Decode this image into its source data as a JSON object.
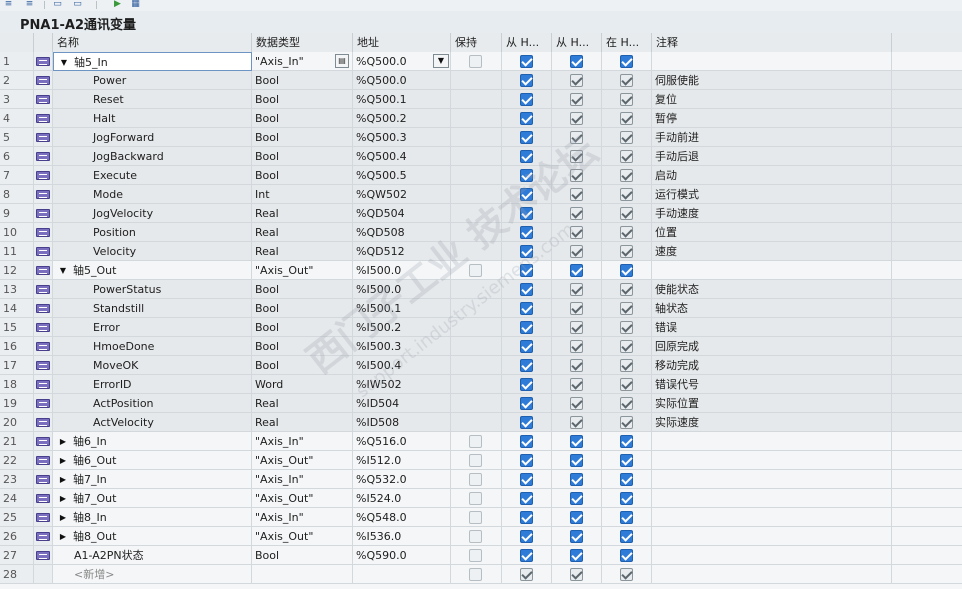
{
  "window": {
    "title": "PNA1-A2通讯变量"
  },
  "toolbar": {
    "icons": [
      "insert-row-icon",
      "add-row-icon",
      "expand-icon",
      "collapse-icon",
      "monitor-icon",
      "watch-icon"
    ]
  },
  "columns": {
    "name": "名称",
    "datatype": "数据类型",
    "address": "地址",
    "retain": "保持",
    "from_hmi1": "从 H...",
    "from_hmi2": "从 H...",
    "in_hmi": "在 H...",
    "comment": "注释"
  },
  "rows": [
    {
      "num": "1",
      "name": "轴5_In",
      "type": "\"Axis_In\"",
      "addr": "%Q500.0",
      "comment": "",
      "kind": "top",
      "expand": "open",
      "selected": true,
      "retain": "off",
      "f1": "on",
      "f2": "on",
      "ih": "on"
    },
    {
      "num": "2",
      "name": "Power",
      "type": "Bool",
      "addr": "%Q500.0",
      "comment": "伺服使能",
      "kind": "child",
      "retain": "none",
      "f1": "on",
      "f2": "gray",
      "ih": "gray"
    },
    {
      "num": "3",
      "name": "Reset",
      "type": "Bool",
      "addr": "%Q500.1",
      "comment": "复位",
      "kind": "child",
      "retain": "none",
      "f1": "on",
      "f2": "gray",
      "ih": "gray"
    },
    {
      "num": "4",
      "name": "Halt",
      "type": "Bool",
      "addr": "%Q500.2",
      "comment": "暂停",
      "kind": "child",
      "retain": "none",
      "f1": "on",
      "f2": "gray",
      "ih": "gray"
    },
    {
      "num": "5",
      "name": "JogForward",
      "type": "Bool",
      "addr": "%Q500.3",
      "comment": "手动前进",
      "kind": "child",
      "retain": "none",
      "f1": "on",
      "f2": "gray",
      "ih": "gray"
    },
    {
      "num": "6",
      "name": "JogBackward",
      "type": "Bool",
      "addr": "%Q500.4",
      "comment": "手动后退",
      "kind": "child",
      "retain": "none",
      "f1": "on",
      "f2": "gray",
      "ih": "gray"
    },
    {
      "num": "7",
      "name": "Execute",
      "type": "Bool",
      "addr": "%Q500.5",
      "comment": "启动",
      "kind": "child",
      "retain": "none",
      "f1": "on",
      "f2": "gray",
      "ih": "gray"
    },
    {
      "num": "8",
      "name": "Mode",
      "type": "Int",
      "addr": "%QW502",
      "comment": "运行模式",
      "kind": "child",
      "retain": "none",
      "f1": "on",
      "f2": "gray",
      "ih": "gray"
    },
    {
      "num": "9",
      "name": "JogVelocity",
      "type": "Real",
      "addr": "%QD504",
      "comment": "手动速度",
      "kind": "child",
      "retain": "none",
      "f1": "on",
      "f2": "gray",
      "ih": "gray"
    },
    {
      "num": "10",
      "name": "Position",
      "type": "Real",
      "addr": "%QD508",
      "comment": "位置",
      "kind": "child",
      "retain": "none",
      "f1": "on",
      "f2": "gray",
      "ih": "gray"
    },
    {
      "num": "11",
      "name": "Velocity",
      "type": "Real",
      "addr": "%QD512",
      "comment": "速度",
      "kind": "child",
      "retain": "none",
      "f1": "on",
      "f2": "gray",
      "ih": "gray"
    },
    {
      "num": "12",
      "name": "轴5_Out",
      "type": "\"Axis_Out\"",
      "addr": "%I500.0",
      "comment": "",
      "kind": "top",
      "expand": "open",
      "retain": "off",
      "f1": "on",
      "f2": "on",
      "ih": "on"
    },
    {
      "num": "13",
      "name": "PowerStatus",
      "type": "Bool",
      "addr": "%I500.0",
      "comment": "使能状态",
      "kind": "child",
      "retain": "none",
      "f1": "on",
      "f2": "gray",
      "ih": "gray"
    },
    {
      "num": "14",
      "name": "Standstill",
      "type": "Bool",
      "addr": "%I500.1",
      "comment": "轴状态",
      "kind": "child",
      "retain": "none",
      "f1": "on",
      "f2": "gray",
      "ih": "gray"
    },
    {
      "num": "15",
      "name": "Error",
      "type": "Bool",
      "addr": "%I500.2",
      "comment": "错误",
      "kind": "child",
      "retain": "none",
      "f1": "on",
      "f2": "gray",
      "ih": "gray"
    },
    {
      "num": "16",
      "name": "HmoeDone",
      "type": "Bool",
      "addr": "%I500.3",
      "comment": "回原完成",
      "kind": "child",
      "retain": "none",
      "f1": "on",
      "f2": "gray",
      "ih": "gray"
    },
    {
      "num": "17",
      "name": "MoveOK",
      "type": "Bool",
      "addr": "%I500.4",
      "comment": "移动完成",
      "kind": "child",
      "retain": "none",
      "f1": "on",
      "f2": "gray",
      "ih": "gray"
    },
    {
      "num": "18",
      "name": "ErrorID",
      "type": "Word",
      "addr": "%IW502",
      "comment": "错误代号",
      "kind": "child",
      "retain": "none",
      "f1": "on",
      "f2": "gray",
      "ih": "gray"
    },
    {
      "num": "19",
      "name": "ActPosition",
      "type": "Real",
      "addr": "%ID504",
      "comment": "实际位置",
      "kind": "child",
      "retain": "none",
      "f1": "on",
      "f2": "gray",
      "ih": "gray"
    },
    {
      "num": "20",
      "name": "ActVelocity",
      "type": "Real",
      "addr": "%ID508",
      "comment": "实际速度",
      "kind": "child",
      "retain": "none",
      "f1": "on",
      "f2": "gray",
      "ih": "gray"
    },
    {
      "num": "21",
      "name": "轴6_In",
      "type": "\"Axis_In\"",
      "addr": "%Q516.0",
      "comment": "",
      "kind": "top",
      "expand": "closed",
      "retain": "off",
      "f1": "on",
      "f2": "on",
      "ih": "on"
    },
    {
      "num": "22",
      "name": "轴6_Out",
      "type": "\"Axis_Out\"",
      "addr": "%I512.0",
      "comment": "",
      "kind": "top",
      "expand": "closed",
      "retain": "off",
      "f1": "on",
      "f2": "on",
      "ih": "on"
    },
    {
      "num": "23",
      "name": "轴7_In",
      "type": "\"Axis_In\"",
      "addr": "%Q532.0",
      "comment": "",
      "kind": "top",
      "expand": "closed",
      "retain": "off",
      "f1": "on",
      "f2": "on",
      "ih": "on"
    },
    {
      "num": "24",
      "name": "轴7_Out",
      "type": "\"Axis_Out\"",
      "addr": "%I524.0",
      "comment": "",
      "kind": "top",
      "expand": "closed",
      "retain": "off",
      "f1": "on",
      "f2": "on",
      "ih": "on"
    },
    {
      "num": "25",
      "name": "轴8_In",
      "type": "\"Axis_In\"",
      "addr": "%Q548.0",
      "comment": "",
      "kind": "top",
      "expand": "closed",
      "retain": "off",
      "f1": "on",
      "f2": "on",
      "ih": "on"
    },
    {
      "num": "26",
      "name": "轴8_Out",
      "type": "\"Axis_Out\"",
      "addr": "%I536.0",
      "comment": "",
      "kind": "top",
      "expand": "closed",
      "retain": "off",
      "f1": "on",
      "f2": "on",
      "ih": "on"
    },
    {
      "num": "27",
      "name": "A1-A2PN状态",
      "type": "Bool",
      "addr": "%Q590.0",
      "comment": "",
      "kind": "plain",
      "retain": "off",
      "f1": "on",
      "f2": "on",
      "ih": "on"
    },
    {
      "num": "28",
      "name": "<新增>",
      "type": "",
      "addr": "",
      "comment": "",
      "kind": "new",
      "retain": "off",
      "f1": "gray",
      "f2": "gray",
      "ih": "gray"
    }
  ],
  "watermark": {
    "text": "西门子工业 技术论坛",
    "url": "support.industry.siemens.com"
  },
  "colors": {
    "accent": "#2f7bd8",
    "header_bg": "#e7ebee",
    "child_row_bg": "#e6e9eb",
    "var_icon": "#7a6fbf"
  }
}
